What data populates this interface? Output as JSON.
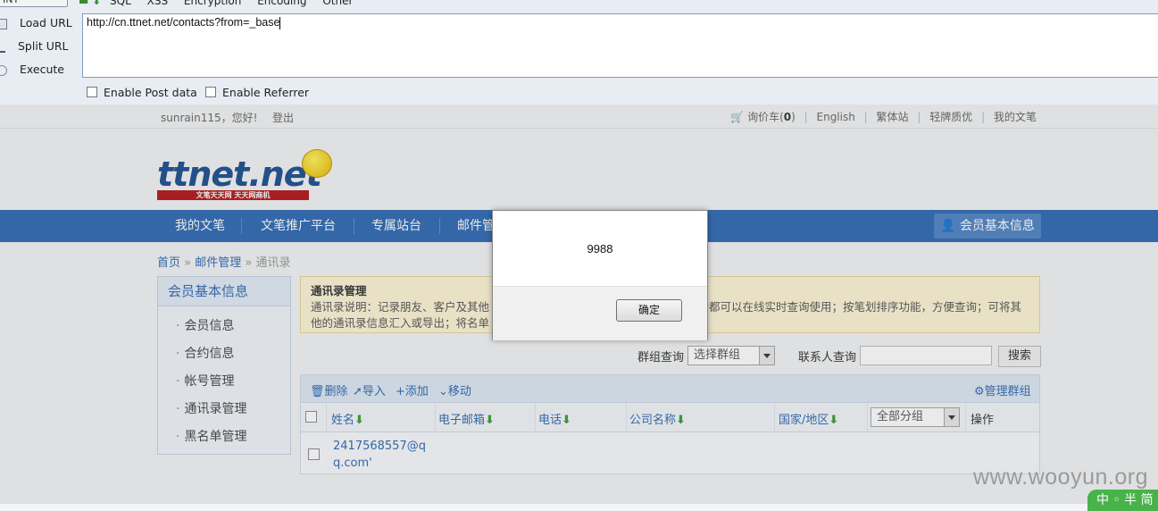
{
  "hackbar": {
    "top_button": "INT",
    "menu": [
      "SQL",
      "XSS",
      "Encryption",
      "Encoding",
      "Other"
    ],
    "actions": [
      "Load URL",
      "Split URL",
      "Execute"
    ],
    "url_value": "http://cn.ttnet.net/contacts?from=_base",
    "checkbox_post": "Enable Post data",
    "checkbox_referrer": "Enable Referrer"
  },
  "site": {
    "welcome": "sunrain115，您好!",
    "logout": "登出",
    "top_links": {
      "cart": "询价车(",
      "cart_count": "0",
      "cart_close": ")",
      "english": "English",
      "traditional": "繁体站",
      "light": "轻牌质优",
      "mine": "我的文笔"
    },
    "logo_text": "ttnet.net",
    "logo_tagline": "文笔天天网   天天网商机",
    "nav": [
      "我的文笔",
      "文笔推广平台",
      "专属站台",
      "邮件管"
    ],
    "member_button": "会员基本信息",
    "breadcrumb": {
      "home": "首页",
      "sep1": " » ",
      "mail": "邮件管理",
      "sep2": " » ",
      "current": "通讯录"
    },
    "sidebar": {
      "title": "会员基本信息",
      "items": [
        "会员信息",
        "合约信息",
        "帐号管理",
        "通讯录管理",
        "黑名单管理"
      ]
    },
    "notice": {
      "title": "通讯录管理",
      "line1_a": "通讯录说明：记录朋友、客户及其他",
      "line1_b": "都可以在线实时查询使用；按笔划排序功能，方便查询；可将其",
      "line2": "他的通讯录信息汇入或导出；将名单"
    },
    "search": {
      "group_label": "群组查询",
      "group_select": "选择群组",
      "contact_label": "联系人查询",
      "contact_value": "",
      "button": "搜索"
    },
    "toolbar": {
      "delete": "删除",
      "import": "导入",
      "add": "添加",
      "move": "移动",
      "manage": "管理群组"
    },
    "columns": [
      "姓名",
      "电子邮箱",
      "电话",
      "公司名称",
      "国家/地区"
    ],
    "group_filter": "全部分组",
    "ops_header": "操作",
    "rows": [
      {
        "name": "2417568557@qq.com'"
      }
    ]
  },
  "dialog": {
    "message": "9988",
    "ok": "确定"
  },
  "watermark": "www.wooyun.org",
  "corner_badge": "中 ◦ 半 简"
}
